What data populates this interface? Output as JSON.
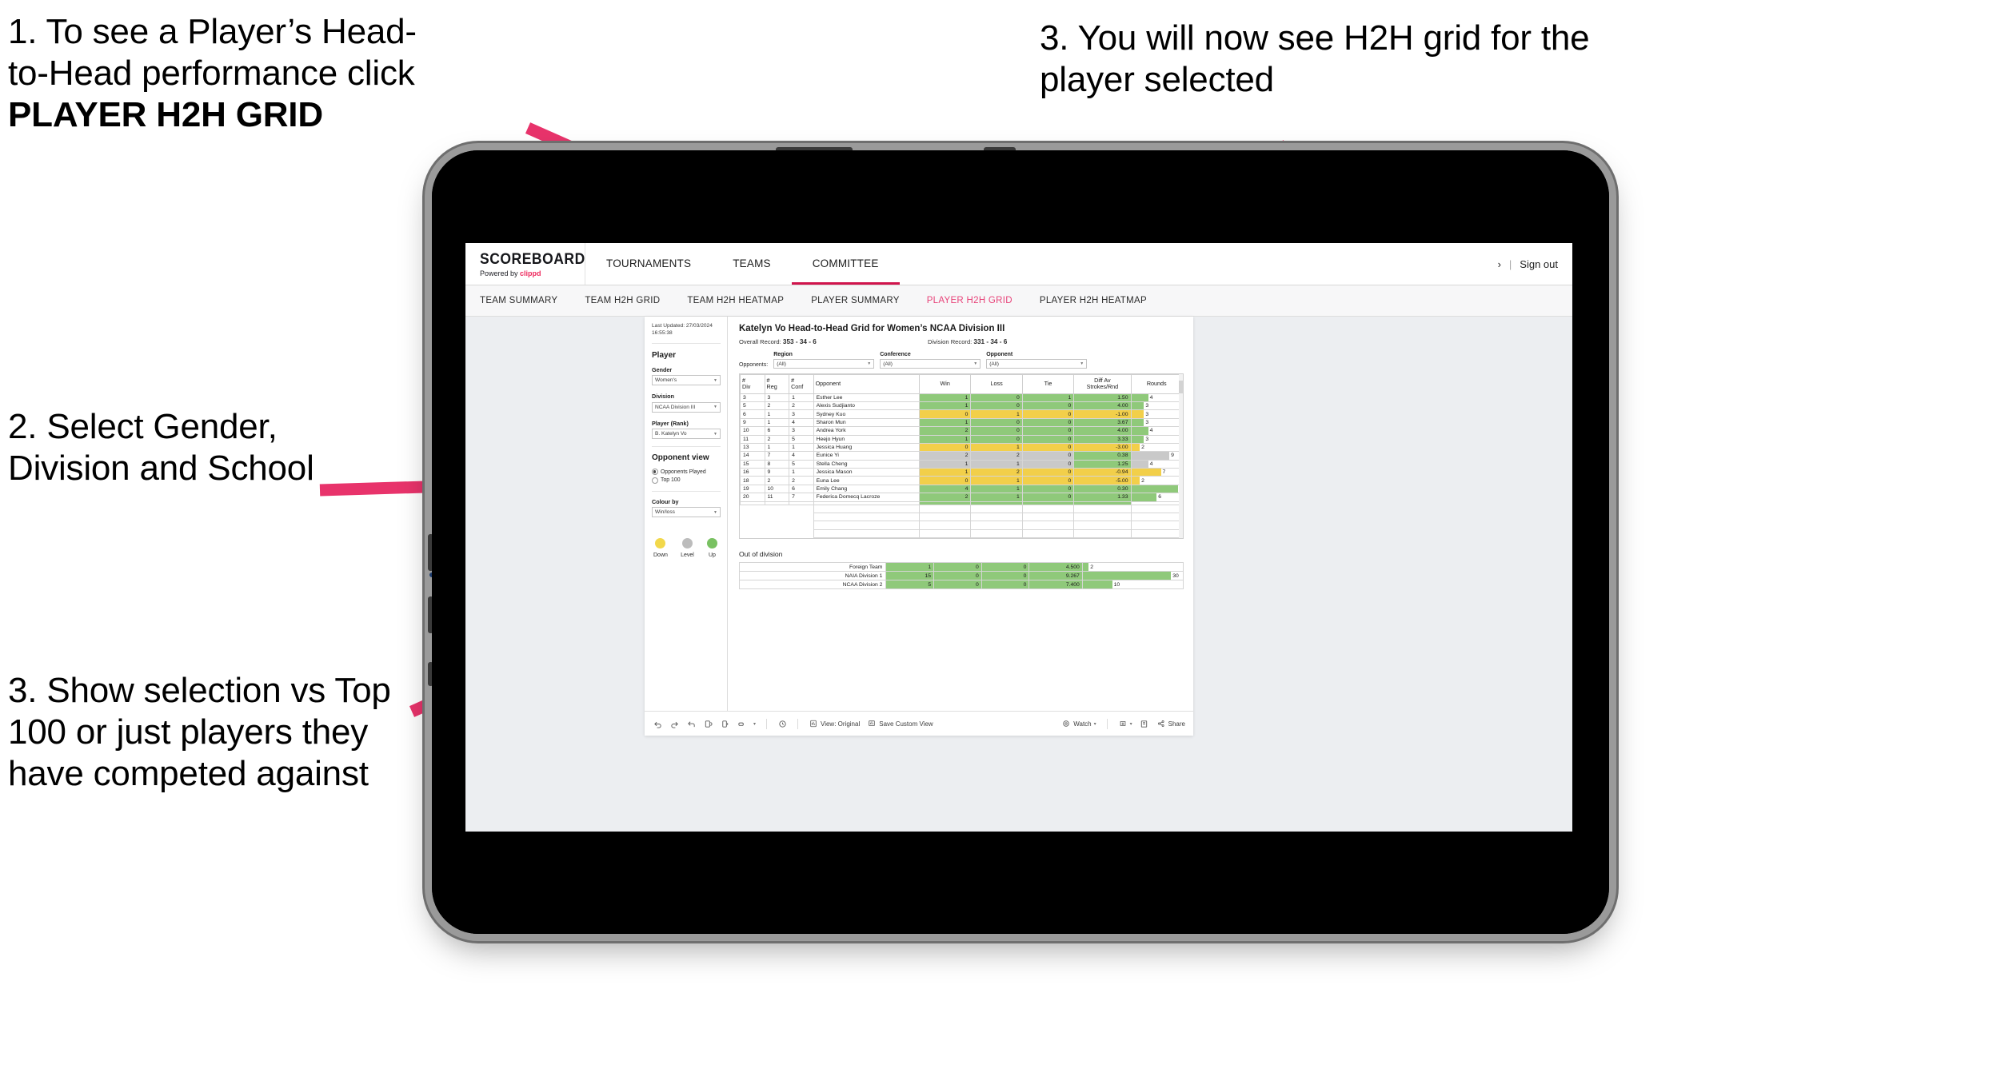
{
  "annotations": [
    {
      "id": "c1",
      "lines": [
        "1. To see a Player’s Head-",
        "to-Head performance click"
      ],
      "bold": "PLAYER H2H GRID"
    },
    {
      "id": "c2",
      "text": "2. Select Gender, Division and School"
    },
    {
      "id": "c3",
      "text": "3. Show selection vs Top 100 or just players they have competed against"
    },
    {
      "id": "c4",
      "text": "3. You will now see H2H grid for the player selected"
    }
  ],
  "app": {
    "brand": {
      "name": "SCOREBOARD",
      "powered_prefix": "Powered by ",
      "powered_brand": "clippd"
    },
    "topnav": [
      {
        "label": "TOURNAMENTS",
        "active": false
      },
      {
        "label": "TEAMS",
        "active": false
      },
      {
        "label": "COMMITTEE",
        "active": true
      }
    ],
    "topright": {
      "chevron": "›",
      "separator": "|",
      "signout": "Sign out"
    },
    "subnav": [
      {
        "label": "TEAM SUMMARY",
        "active": false
      },
      {
        "label": "TEAM H2H GRID",
        "active": false
      },
      {
        "label": "TEAM H2H HEATMAP",
        "active": false
      },
      {
        "label": "PLAYER SUMMARY",
        "active": false
      },
      {
        "label": "PLAYER H2H GRID",
        "active": true
      },
      {
        "label": "PLAYER H2H HEATMAP",
        "active": false
      }
    ]
  },
  "sidebar": {
    "last_updated": "Last Updated: 27/03/2024 16:55:38",
    "player_section_title": "Player",
    "fields": [
      {
        "label": "Gender",
        "value": "Women's"
      },
      {
        "label": "Division",
        "value": "NCAA Division III"
      },
      {
        "label": "Player (Rank)",
        "value": "B. Katelyn Vo"
      }
    ],
    "opponent_view": {
      "title": "Opponent view",
      "options": [
        {
          "label": "Opponents Played",
          "selected": true
        },
        {
          "label": "Top 100",
          "selected": false
        }
      ]
    },
    "colour_by": {
      "label": "Colour by",
      "value": "Win/loss"
    },
    "legend": [
      {
        "label": "Down",
        "color": "#f2d84b"
      },
      {
        "label": "Level",
        "color": "#bcbcbc"
      },
      {
        "label": "Up",
        "color": "#79c162"
      }
    ]
  },
  "main": {
    "title": "Katelyn Vo Head-to-Head Grid for Women’s NCAA Division III",
    "overall_record_label": "Overall Record:",
    "overall_record_value": "353 -  34 - 6",
    "division_record_label": "Division Record:",
    "division_record_value": "331 -  34 - 6",
    "opponents_label": "Opponents:",
    "filters": [
      {
        "label": "Region",
        "value": "(All)"
      },
      {
        "label": "Conference",
        "value": "(All)"
      },
      {
        "label": "Opponent",
        "value": "(All)"
      }
    ],
    "columns": [
      "#\nDiv",
      "#\nReg",
      "#\nConf",
      "Opponent",
      "Win",
      "Loss",
      "Tie",
      "Diff Av\nStrokes/Rnd",
      "Rounds"
    ],
    "out_of_division_title": "Out of division"
  },
  "chart_data": {
    "type": "table",
    "title": "Katelyn Vo Head-to-Head Grid for Women’s NCAA Division III",
    "columns": [
      "# Div",
      "# Reg",
      "# Conf",
      "Opponent",
      "Win",
      "Loss",
      "Tie",
      "Diff Av Strokes/Rnd",
      "Rounds"
    ],
    "rows": [
      {
        "div": "3",
        "reg": "3",
        "conf": "1",
        "opponent": "Esther Lee",
        "win": "1",
        "loss": "0",
        "tie": "1",
        "diff": "1.50",
        "rounds": "4",
        "rounds_n": 4,
        "color": "#8fc97a"
      },
      {
        "div": "5",
        "reg": "2",
        "conf": "2",
        "opponent": "Alexis Sudjianto",
        "win": "1",
        "loss": "0",
        "tie": "0",
        "diff": "4.00",
        "rounds": "3",
        "rounds_n": 3,
        "color": "#8fc97a"
      },
      {
        "div": "6",
        "reg": "1",
        "conf": "3",
        "opponent": "Sydney Kuo",
        "win": "0",
        "loss": "1",
        "tie": "0",
        "diff": "-1.00",
        "rounds": "3",
        "rounds_n": 3,
        "color": "#f2cf4a"
      },
      {
        "div": "9",
        "reg": "1",
        "conf": "4",
        "opponent": "Sharon Mun",
        "win": "1",
        "loss": "0",
        "tie": "0",
        "diff": "3.67",
        "rounds": "3",
        "rounds_n": 3,
        "color": "#8fc97a"
      },
      {
        "div": "10",
        "reg": "6",
        "conf": "3",
        "opponent": "Andrea York",
        "win": "2",
        "loss": "0",
        "tie": "0",
        "diff": "4.00",
        "rounds": "4",
        "rounds_n": 4,
        "color": "#8fc97a"
      },
      {
        "div": "11",
        "reg": "2",
        "conf": "5",
        "opponent": "Heejo Hyun",
        "win": "1",
        "loss": "0",
        "tie": "0",
        "diff": "3.33",
        "rounds": "3",
        "rounds_n": 3,
        "color": "#8fc97a"
      },
      {
        "div": "13",
        "reg": "1",
        "conf": "1",
        "opponent": "Jessica Huang",
        "win": "0",
        "loss": "1",
        "tie": "0",
        "diff": "-3.00",
        "rounds": "2",
        "rounds_n": 2,
        "color": "#f2cf4a"
      },
      {
        "div": "14",
        "reg": "7",
        "conf": "4",
        "opponent": "Eunice Yi",
        "win": "2",
        "loss": "2",
        "tie": "0",
        "diff": "0.38",
        "rounds": "9",
        "rounds_n": 9,
        "color": "#c9c9c9",
        "diff_color": "#8fc97a"
      },
      {
        "div": "15",
        "reg": "8",
        "conf": "5",
        "opponent": "Stella Cheng",
        "win": "1",
        "loss": "1",
        "tie": "0",
        "diff": "1.25",
        "rounds": "4",
        "rounds_n": 4,
        "color": "#c9c9c9",
        "diff_color": "#8fc97a"
      },
      {
        "div": "16",
        "reg": "9",
        "conf": "1",
        "opponent": "Jessica Mason",
        "win": "1",
        "loss": "2",
        "tie": "0",
        "diff": "-0.94",
        "rounds": "7",
        "rounds_n": 7,
        "color": "#f2cf4a"
      },
      {
        "div": "18",
        "reg": "2",
        "conf": "2",
        "opponent": "Euna Lee",
        "win": "0",
        "loss": "1",
        "tie": "0",
        "diff": "-5.00",
        "rounds": "2",
        "rounds_n": 2,
        "color": "#f2cf4a"
      },
      {
        "div": "19",
        "reg": "10",
        "conf": "6",
        "opponent": "Emily Chang",
        "win": "4",
        "loss": "1",
        "tie": "0",
        "diff": "0.30",
        "rounds": "11",
        "rounds_n": 11,
        "color": "#8fc97a"
      },
      {
        "div": "20",
        "reg": "11",
        "conf": "7",
        "opponent": "Federica Domecq Lacroze",
        "win": "2",
        "loss": "1",
        "tie": "0",
        "diff": "1.33",
        "rounds": "6",
        "rounds_n": 6,
        "color": "#8fc97a"
      }
    ],
    "rounds_max": 12,
    "out_of_division": [
      {
        "name": "Foreign Team",
        "win": "1",
        "loss": "0",
        "tie": "0",
        "diff": "4.500",
        "rounds": "2",
        "rounds_n": 2,
        "color": "#8fc97a"
      },
      {
        "name": "NAIA Division 1",
        "win": "15",
        "loss": "0",
        "tie": "0",
        "diff": "9.267",
        "rounds": "30",
        "rounds_n": 30,
        "color": "#8fc97a"
      },
      {
        "name": "NCAA Division 2",
        "win": "5",
        "loss": "0",
        "tie": "0",
        "diff": "7.400",
        "rounds": "10",
        "rounds_n": 10,
        "color": "#8fc97a"
      }
    ],
    "out_of_division_rounds_max": 34
  },
  "toolbar": {
    "view_label": "View: Original",
    "save_label": "Save Custom View",
    "watch_label": "Watch",
    "share_label": "Share",
    "caret": "▾"
  },
  "colors": {
    "accent_pink": "#e8447a",
    "brand_red": "#d0144c",
    "win_green": "#8fc97a",
    "loss_yellow": "#f2cf4a",
    "level_grey": "#c9c9c9",
    "arrow_pink": "#e8336b"
  }
}
